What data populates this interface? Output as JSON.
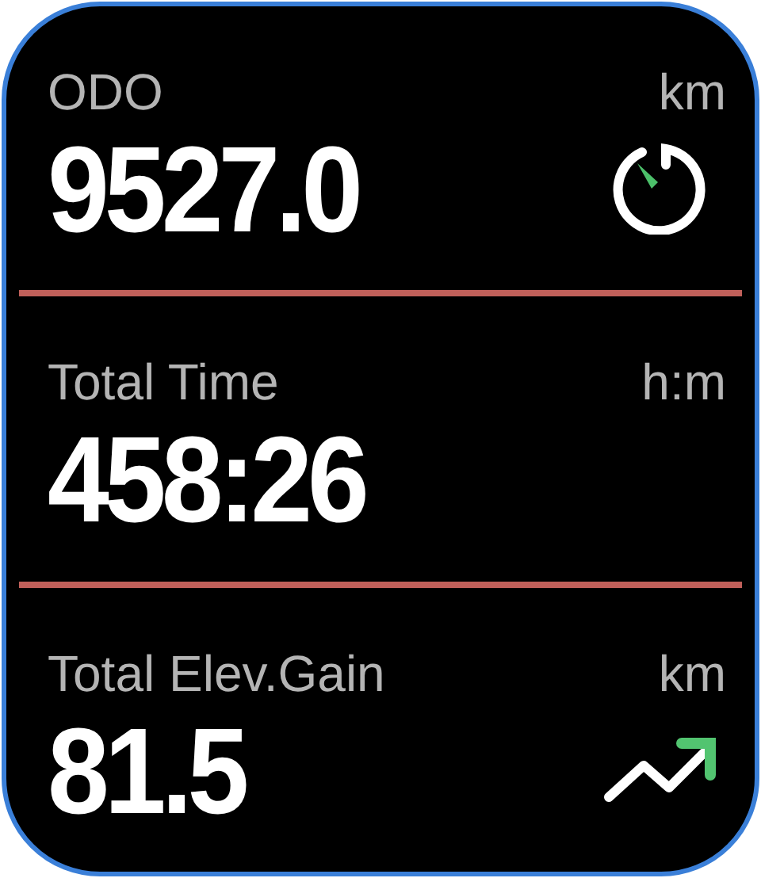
{
  "metrics": [
    {
      "label": "ODO",
      "unit": "km",
      "value": "9527.0",
      "kind": "timer"
    },
    {
      "label": "Total Time",
      "unit": "h:m",
      "value": "458:26",
      "kind": "plain"
    },
    {
      "label": "Total Elev.Gain",
      "unit": "km",
      "value": "81.5",
      "kind": "trend"
    }
  ]
}
